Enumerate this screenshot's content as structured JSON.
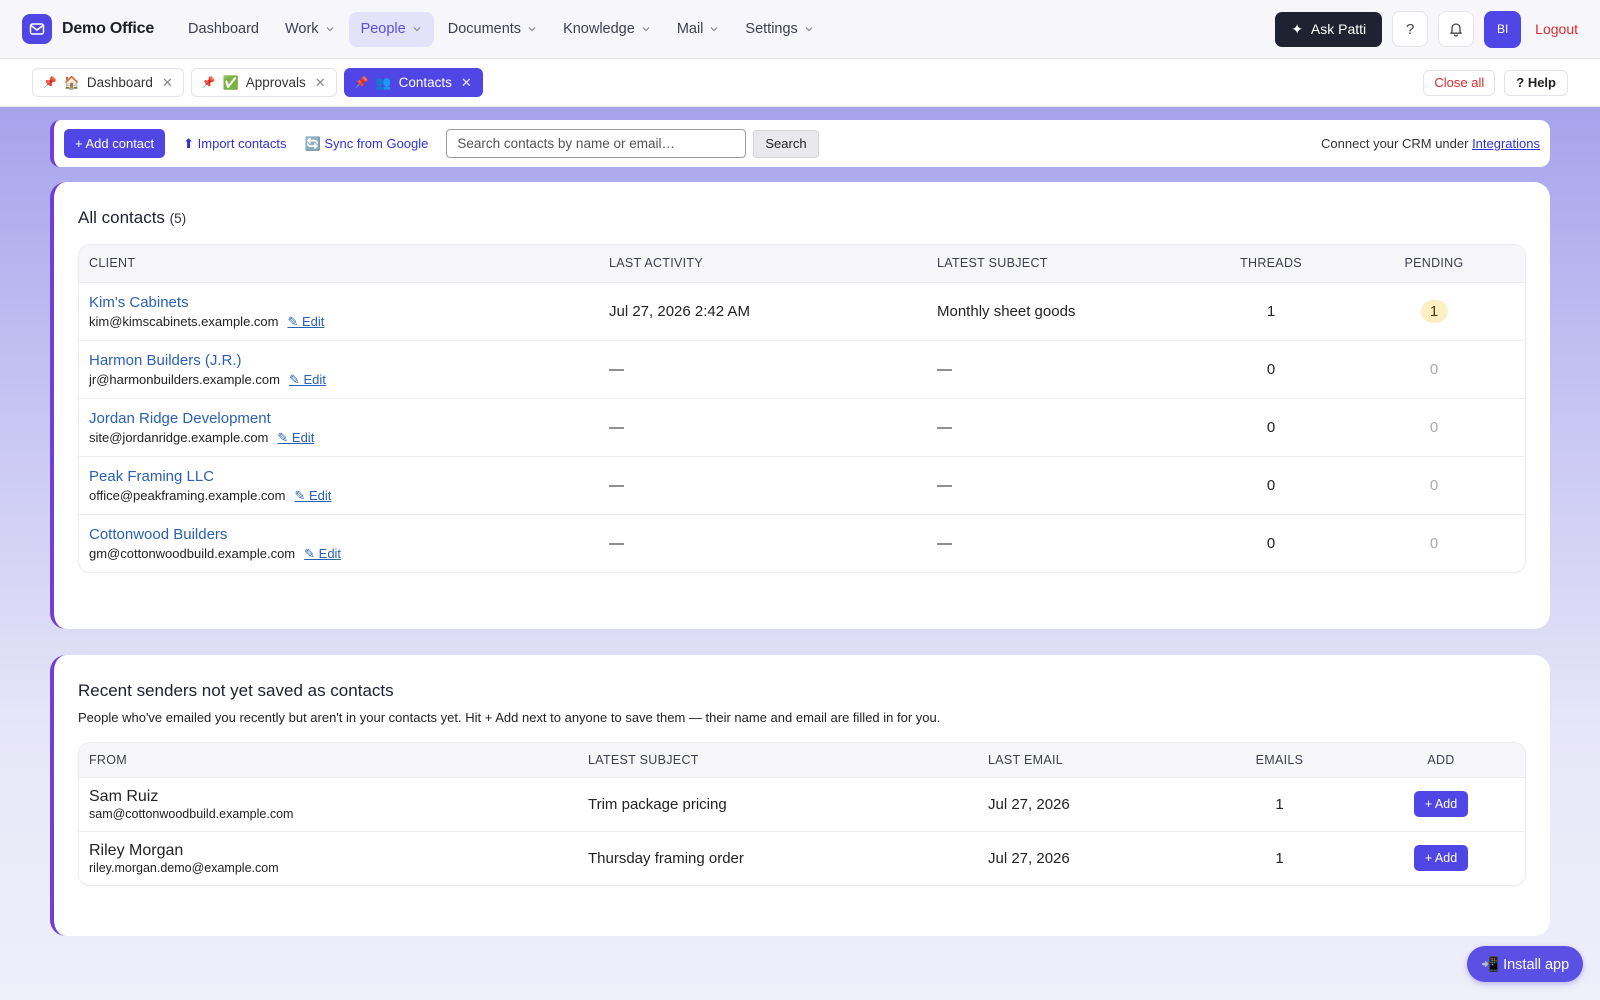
{
  "brand": {
    "name": "Demo Office"
  },
  "nav": {
    "items": [
      {
        "label": "Dashboard",
        "dropdown": false,
        "active": false
      },
      {
        "label": "Work",
        "dropdown": true,
        "active": false
      },
      {
        "label": "People",
        "dropdown": true,
        "active": true
      },
      {
        "label": "Documents",
        "dropdown": true,
        "active": false
      },
      {
        "label": "Knowledge",
        "dropdown": true,
        "active": false
      },
      {
        "label": "Mail",
        "dropdown": true,
        "active": false
      },
      {
        "label": "Settings",
        "dropdown": true,
        "active": false
      }
    ],
    "ask_label": "Ask Patti",
    "help_glyph": "?",
    "avatar_initials": "BI",
    "logout_label": "Logout"
  },
  "tabs": {
    "items": [
      {
        "pin": "📌",
        "emoji": "🏠",
        "label": "Dashboard",
        "active": false
      },
      {
        "pin": "📌",
        "emoji": "✅",
        "label": "Approvals",
        "active": false
      },
      {
        "pin": "📌",
        "emoji": "👥",
        "label": "Contacts",
        "active": true
      }
    ],
    "close_glyph": "✕",
    "close_all_label": "Close all",
    "help_label": "? Help"
  },
  "toolbar": {
    "add_contact_label": "+ Add contact",
    "import_label": "⬆ Import contacts",
    "sync_label": "🔄 Sync from Google",
    "search_placeholder": "Search contacts by name or email…",
    "search_button": "Search",
    "crm_text": "Connect your CRM under ",
    "crm_link": "Integrations"
  },
  "contacts": {
    "title": "All contacts",
    "count": "(5)",
    "columns": [
      "CLIENT",
      "LAST ACTIVITY",
      "LATEST SUBJECT",
      "THREADS",
      "PENDING"
    ],
    "edit_label": "✎ Edit",
    "rows": [
      {
        "name": "Kim's Cabinets",
        "email": "kim@kimscabinets.example.com",
        "last_activity": "Jul 27, 2026 2:42 AM",
        "subject": "Monthly sheet goods",
        "threads": "1",
        "pending": "1",
        "pending_highlight": true
      },
      {
        "name": "Harmon Builders (J.R.)",
        "email": "jr@harmonbuilders.example.com",
        "last_activity": "—",
        "subject": "—",
        "threads": "0",
        "pending": "0",
        "pending_highlight": false
      },
      {
        "name": "Jordan Ridge Development",
        "email": "site@jordanridge.example.com",
        "last_activity": "—",
        "subject": "—",
        "threads": "0",
        "pending": "0",
        "pending_highlight": false
      },
      {
        "name": "Peak Framing LLC",
        "email": "office@peakframing.example.com",
        "last_activity": "—",
        "subject": "—",
        "threads": "0",
        "pending": "0",
        "pending_highlight": false
      },
      {
        "name": "Cottonwood Builders",
        "email": "gm@cottonwoodbuild.example.com",
        "last_activity": "—",
        "subject": "—",
        "threads": "0",
        "pending": "0",
        "pending_highlight": false
      }
    ]
  },
  "recent": {
    "title": "Recent senders not yet saved as contacts",
    "description": "People who've emailed you recently but aren't in your contacts yet. Hit + Add next to anyone to save them — their name and email are filled in for you.",
    "columns": [
      "FROM",
      "LATEST SUBJECT",
      "LAST EMAIL",
      "EMAILS",
      "ADD"
    ],
    "add_label": "+ Add",
    "rows": [
      {
        "name": "Sam Ruiz",
        "email": "sam@cottonwoodbuild.example.com",
        "subject": "Trim package pricing",
        "last_email": "Jul 27, 2026",
        "emails": "1"
      },
      {
        "name": "Riley Morgan",
        "email": "riley.morgan.demo@example.com",
        "subject": "Thursday framing order",
        "last_email": "Jul 27, 2026",
        "emails": "1"
      }
    ]
  },
  "install": {
    "label": "📲 Install app"
  },
  "colors": {
    "accent": "#4f46e5",
    "danger": "#d92d2d",
    "link": "#2a61b5",
    "pending_badge": "#fcefc4"
  }
}
